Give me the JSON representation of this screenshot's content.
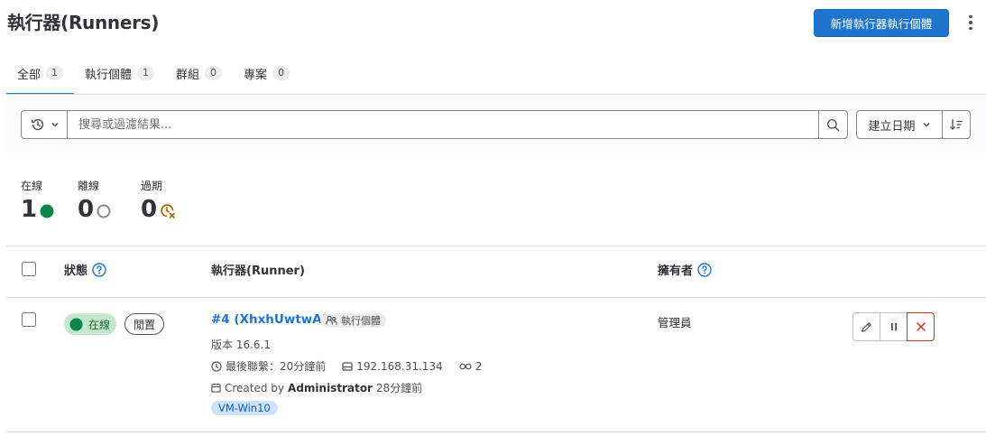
{
  "header": {
    "title": "執行器(Runners)",
    "new_runner_button": "新增執行器執行個體"
  },
  "tabs": [
    {
      "label": "全部",
      "count": "1",
      "active": true
    },
    {
      "label": "執行個體",
      "count": "1"
    },
    {
      "label": "群組",
      "count": "0"
    },
    {
      "label": "專案",
      "count": "0"
    }
  ],
  "filter": {
    "search_placeholder": "搜尋或過濾結果...",
    "sort_label": "建立日期"
  },
  "stats": {
    "online": {
      "label": "在線",
      "value": "1",
      "color": "#108548"
    },
    "offline": {
      "label": "離線",
      "value": "0",
      "color": "#89888d"
    },
    "stale": {
      "label": "過期",
      "value": "0",
      "color": "#ab6100"
    }
  },
  "table": {
    "headers": {
      "status": "狀態",
      "runner": "執行器(Runner)",
      "owner": "擁有者"
    },
    "rows": [
      {
        "status_online": "在線",
        "status_idle": "閒置",
        "runner_name": "#4 (XhxhUwtwA)",
        "runner_type": "執行個體",
        "version": "版本 16.6.1",
        "last_contact": "最後聯繫：20分鐘前",
        "ip": "192.168.31.134",
        "jobs": "2",
        "created_prefix": "Created by",
        "created_by": "Administrator",
        "created_time": "28分鐘前",
        "tag": "VM-Win10",
        "owner": "管理員"
      }
    ]
  },
  "colors": {
    "primary": "#1f75cb",
    "online_green": "#108548",
    "danger_red": "#dd2b0e"
  }
}
